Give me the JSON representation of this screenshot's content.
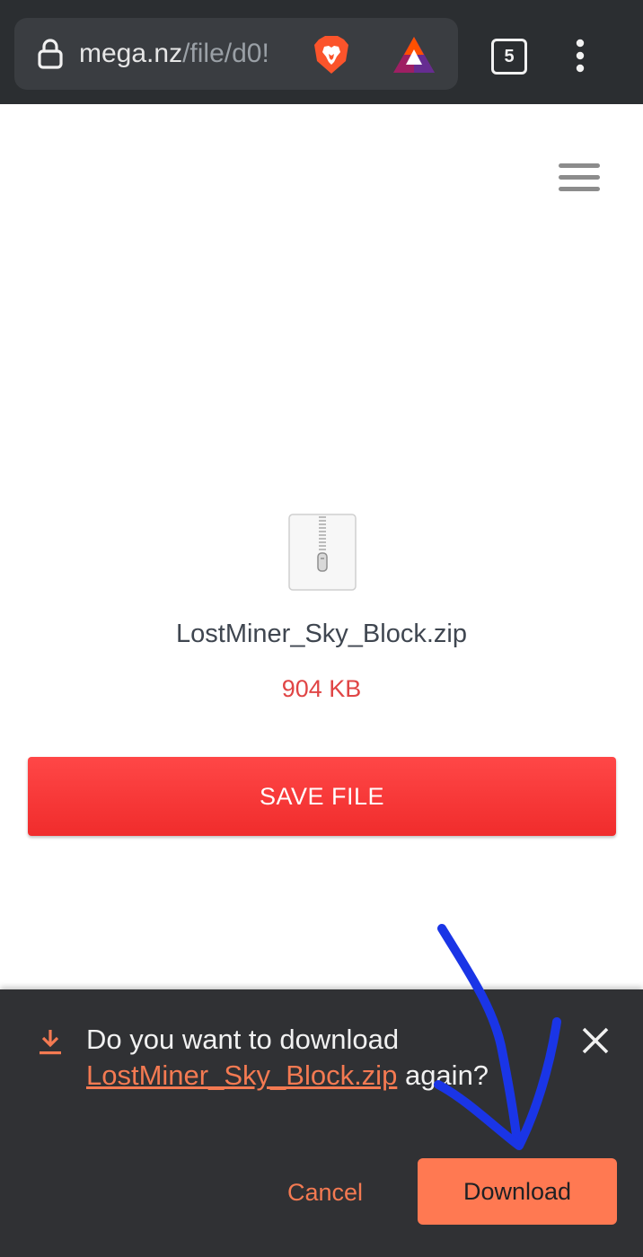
{
  "browser": {
    "url_host": "mega.nz",
    "url_path": "/file/d0!",
    "tab_count": "5",
    "icons": [
      "lock-icon",
      "brave-shield-icon",
      "bat-rewards-icon",
      "overflow-menu-icon"
    ]
  },
  "page": {
    "menu_icon": "hamburger-menu-icon",
    "file_icon": "zip-file-icon",
    "file_name": "LostMiner_Sky_Block.zip",
    "file_size": "904 KB",
    "save_button_label": "SAVE FILE",
    "colors": {
      "save_button": "#f23434",
      "file_size": "#e04545",
      "file_name": "#3f4650"
    }
  },
  "download_prompt": {
    "prefix": "Do you want to download",
    "file_name": "LostMiner_Sky_Block.zip",
    "suffix": "again?",
    "cancel_label": "Cancel",
    "download_label": "Download",
    "icons": [
      "download-icon",
      "close-icon"
    ],
    "colors": {
      "background": "#303134",
      "accent": "#ff7952",
      "text": "#f1f1f1"
    }
  },
  "annotation": {
    "type": "hand-drawn arrow",
    "color": "#1a35e6",
    "points_to": "Download"
  }
}
